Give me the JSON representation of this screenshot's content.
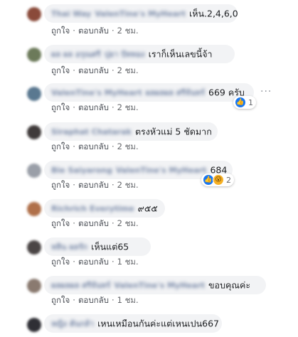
{
  "actions": {
    "like": "ถูกใจ",
    "reply": "ตอบกลับ",
    "separator": "·"
  },
  "more_glyph": "···",
  "comments": [
    {
      "name": "Thai Way",
      "extra": "ValenTine's MyHeart",
      "text": "เห็น.2,4,6,0",
      "time": "2 ชม.",
      "avatar_color": "#8a4a3a"
    },
    {
      "name": "ผล ผล อรุณศรี",
      "extra": "ปุยา ปัททอง",
      "text": "เราก็เห็นเลขนี้จ้า",
      "time": "2 ชม.",
      "avatar_color": "#6c7a5a"
    },
    {
      "name": "ValenTine's MyHeart",
      "extra": "ผลผลผล ศรีจันทร์",
      "text": "669 ครับ",
      "time": "2 ชม.",
      "avatar_color": "#5a7890",
      "reactions": {
        "count": "1"
      }
    },
    {
      "name": "Siraphat Chatarak",
      "extra": "",
      "text": "ตรงหัวแม่ 5 ชัดมาก",
      "time": "2 ชม.",
      "avatar_color": "#3f3a3a"
    },
    {
      "name": "Bie Saiyarong",
      "extra": "ValenTine's MyHeart",
      "text": "684",
      "time": "2 ชม.",
      "avatar_color": "#9a9fa8",
      "reactions": {
        "count": "2"
      }
    },
    {
      "name": "Richrich Everytime",
      "extra": "",
      "text": "๙๕๕",
      "time": "2 ชม.",
      "avatar_color": "#b0704a"
    },
    {
      "name": "หลิน ผลรัก",
      "extra": "",
      "text": "เห็นแต่65",
      "time": "1 ชม.",
      "avatar_color": "#4a4545"
    },
    {
      "name": "ผลผลผล ศรีจันทร์",
      "extra": "ValenTine's MyHeart",
      "text": "ขอบคุณค่ะ",
      "time": "1 ชม.",
      "avatar_color": "#8a7a70"
    },
    {
      "name": "หญิง ต้นกล้า",
      "extra": "",
      "text": "เหนเหมือนกันค่ะแต่เหนเปน667",
      "time": "",
      "avatar_color": "#2f2f35"
    }
  ]
}
